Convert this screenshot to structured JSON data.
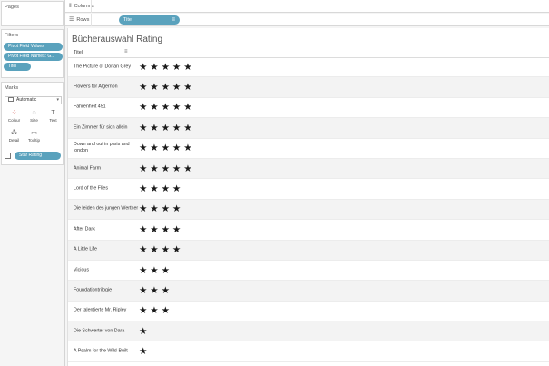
{
  "pages_card": {
    "title": "Pages"
  },
  "filters_card": {
    "title": "Filters",
    "pills": [
      "Pivot Field Values",
      "Pivot Field Names: G..",
      "Titel"
    ]
  },
  "marks_card": {
    "title": "Marks",
    "type": "Automatic",
    "buttons": {
      "colour": "Colour",
      "size": "Size",
      "text": "Text",
      "detail": "Detail",
      "tooltip": "Tooltip"
    },
    "pill": "Star Rating"
  },
  "shelves": {
    "columns_label": "Columns",
    "rows_label": "Rows",
    "rows_pill": "Titel"
  },
  "view": {
    "title": "Bücherauswahl Rating",
    "column_header": "Titel"
  },
  "rows": [
    {
      "title": "The Picture of Dorian Grey",
      "stars": 5
    },
    {
      "title": "Flowers for Algernon",
      "stars": 5
    },
    {
      "title": "Fahrenheit 451",
      "stars": 5
    },
    {
      "title": "Ein Zimmer für sich allein",
      "stars": 5
    },
    {
      "title": "Down and out in paris and london",
      "stars": 5
    },
    {
      "title": "Animal Farm",
      "stars": 5
    },
    {
      "title": "Lord of the Flies",
      "stars": 4
    },
    {
      "title": "Die leiden des jungen Werther",
      "stars": 4
    },
    {
      "title": "After Dark",
      "stars": 4
    },
    {
      "title": "A Little Life",
      "stars": 4
    },
    {
      "title": "Vicious",
      "stars": 3
    },
    {
      "title": "Foundationtrilogie",
      "stars": 3
    },
    {
      "title": "Der talentierte Mr. Ripley",
      "stars": 3
    },
    {
      "title": "Die Schwerter von Dara",
      "stars": 1
    },
    {
      "title": "A Psalm for the Wild-Built",
      "stars": 1
    }
  ],
  "colors": {
    "pill": "#5aa2bd",
    "star": "#1a1a1a",
    "band": "#f3f3f3"
  },
  "icons": {
    "star": "★",
    "sort": "sort-descending-icon"
  }
}
